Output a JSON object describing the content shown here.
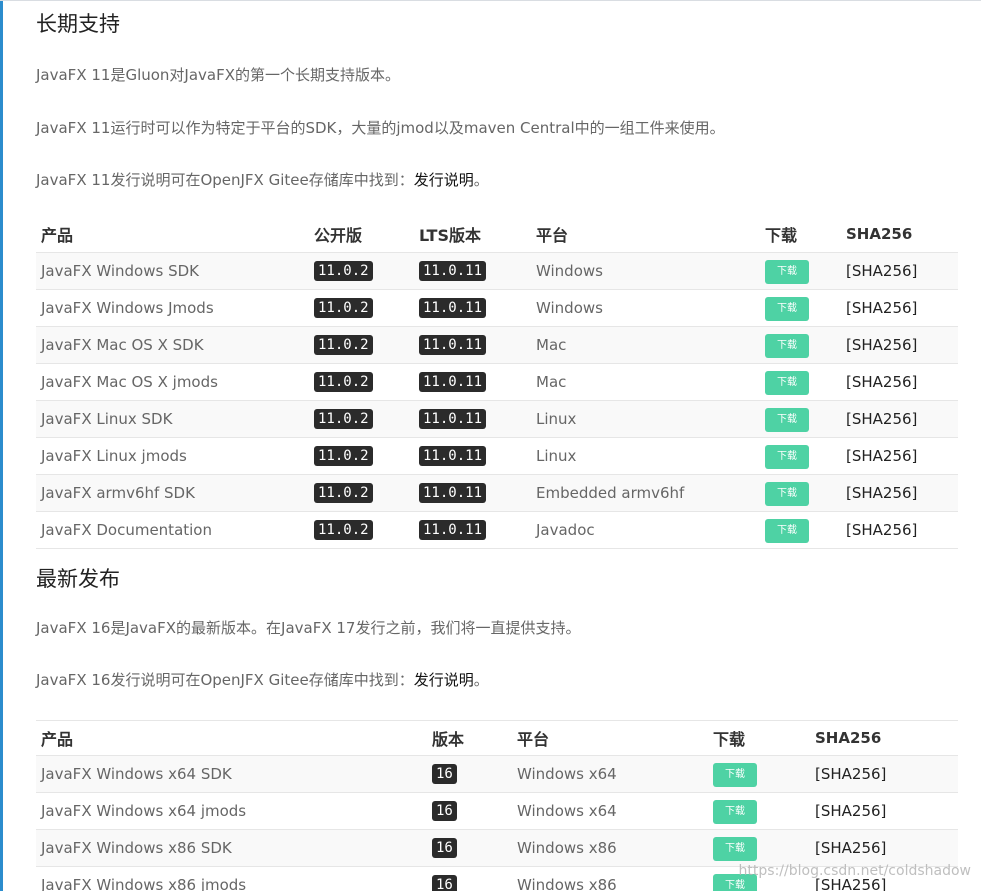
{
  "lts": {
    "title": "长期支持",
    "para1": "JavaFX 11是Gluon对JavaFX的第一个长期支持版本。",
    "para2": "JavaFX 11运行时可以作为特定于平台的SDK，大量的jmod以及maven Central中的一组工件来使用。",
    "para3_prefix": "JavaFX 11发行说明可在OpenJFX Gitee存储库中找到：",
    "para3_link": "发行说明",
    "para3_suffix": "。",
    "headers": [
      "产品",
      "公开版",
      "LTS版本",
      "平台",
      "下载",
      "SHA256"
    ],
    "rows": [
      {
        "product": "JavaFX Windows SDK",
        "public": "11.0.2",
        "lts": "11.0.11",
        "platform": "Windows",
        "download": "下载",
        "sha": "[SHA256]"
      },
      {
        "product": "JavaFX Windows Jmods",
        "public": "11.0.2",
        "lts": "11.0.11",
        "platform": "Windows",
        "download": "下载",
        "sha": "[SHA256]"
      },
      {
        "product": "JavaFX Mac OS X SDK",
        "public": "11.0.2",
        "lts": "11.0.11",
        "platform": "Mac",
        "download": "下载",
        "sha": "[SHA256]"
      },
      {
        "product": "JavaFX Mac OS X jmods",
        "public": "11.0.2",
        "lts": "11.0.11",
        "platform": "Mac",
        "download": "下载",
        "sha": "[SHA256]"
      },
      {
        "product": "JavaFX Linux SDK",
        "public": "11.0.2",
        "lts": "11.0.11",
        "platform": "Linux",
        "download": "下载",
        "sha": "[SHA256]"
      },
      {
        "product": "JavaFX Linux jmods",
        "public": "11.0.2",
        "lts": "11.0.11",
        "platform": "Linux",
        "download": "下载",
        "sha": "[SHA256]"
      },
      {
        "product": "JavaFX armv6hf SDK",
        "public": "11.0.2",
        "lts": "11.0.11",
        "platform": "Embedded armv6hf",
        "download": "下载",
        "sha": "[SHA256]"
      },
      {
        "product": "JavaFX Documentation",
        "public": "11.0.2",
        "lts": "11.0.11",
        "platform": "Javadoc",
        "download": "下载",
        "sha": "[SHA256]"
      }
    ]
  },
  "latest": {
    "title": "最新发布",
    "para1": "JavaFX 16是JavaFX的最新版本。在JavaFX 17发行之前，我们将一直提供支持。",
    "para2_prefix": "JavaFX 16发行说明可在OpenJFX Gitee存储库中找到：",
    "para2_link": "发行说明",
    "para2_suffix": "。",
    "headers": [
      "产品",
      "版本",
      "平台",
      "下载",
      "SHA256"
    ],
    "rows": [
      {
        "product": "JavaFX Windows x64 SDK",
        "version": "16",
        "platform": "Windows x64",
        "download": "下载",
        "sha": "[SHA256]"
      },
      {
        "product": "JavaFX Windows x64 jmods",
        "version": "16",
        "platform": "Windows x64",
        "download": "下载",
        "sha": "[SHA256]"
      },
      {
        "product": "JavaFX Windows x86 SDK",
        "version": "16",
        "platform": "Windows x86",
        "download": "下载",
        "sha": "[SHA256]"
      },
      {
        "product": "JavaFX Windows x86 jmods",
        "version": "16",
        "platform": "Windows x86",
        "download": "下载",
        "sha": "[SHA256]"
      }
    ]
  },
  "watermark": "https://blog.csdn.net/coldshadow",
  "colors": {
    "download_button": "#4ed2a4",
    "version_badge": "#2b2b2b",
    "left_rule": "#2b8ccd"
  }
}
